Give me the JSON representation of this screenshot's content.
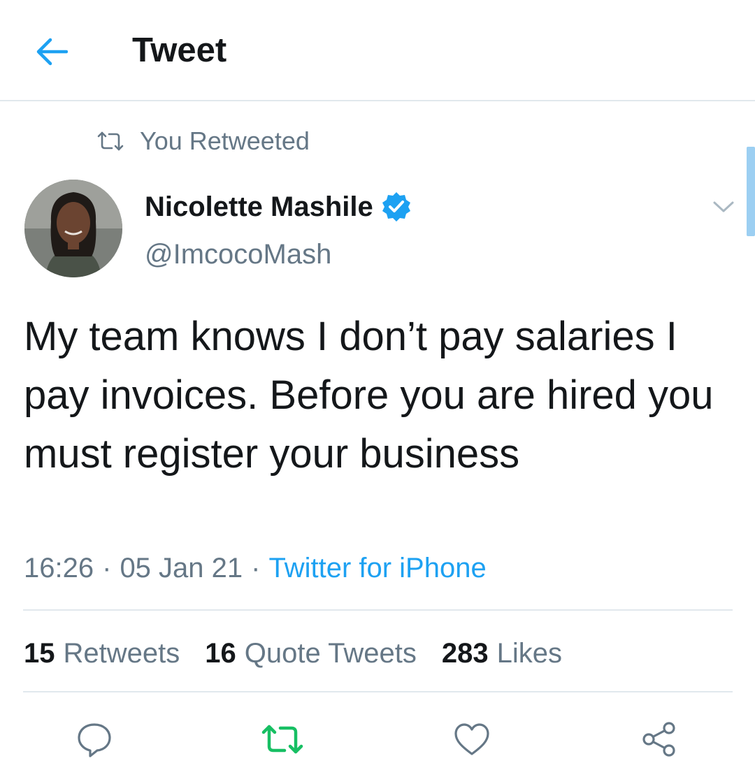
{
  "header": {
    "title": "Tweet"
  },
  "retweet_context": {
    "text": "You Retweeted"
  },
  "author": {
    "name": "Nicolette Mashile",
    "handle": "@ImcocoMash",
    "verified": true
  },
  "tweet": {
    "text": "My team knows I don’t pay salaries I pay invoices. Before you are hired you must register your business",
    "time": "16:26",
    "date": "05 Jan 21",
    "separator": "·",
    "source": "Twitter for iPhone"
  },
  "stats": {
    "retweets": {
      "count": "15",
      "label": "Retweets"
    },
    "quote_tweets": {
      "count": "16",
      "label": "Quote Tweets"
    },
    "likes": {
      "count": "283",
      "label": "Likes"
    }
  },
  "actions": {
    "reply_icon": "reply-icon",
    "retweet_icon": "retweet-icon",
    "retweeted": true,
    "like_icon": "heart-icon",
    "share_icon": "share-icon"
  },
  "colors": {
    "accent": "#1da1f2",
    "retweet_active": "#17bf63",
    "secondary_text": "#657786",
    "primary_text": "#14171a",
    "divider": "#e1e8ed"
  }
}
